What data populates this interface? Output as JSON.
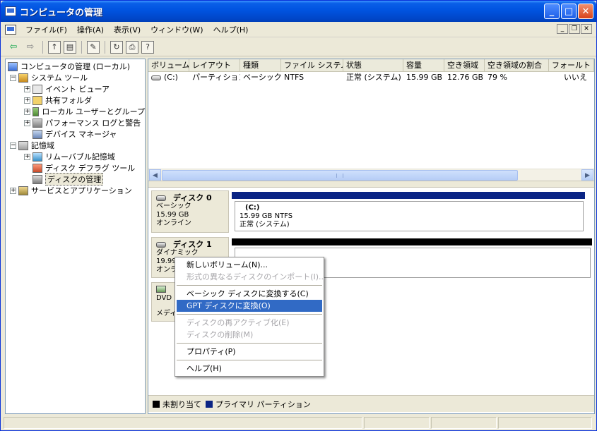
{
  "window": {
    "title": "コンピュータの管理"
  },
  "menu": {
    "items": [
      "ファイル(F)",
      "操作(A)",
      "表示(V)",
      "ウィンドウ(W)",
      "ヘルプ(H)"
    ]
  },
  "tree": {
    "items": [
      {
        "label": "コンピュータの管理 (ローカル)"
      },
      {
        "label": "システム ツール"
      },
      {
        "label": "イベント ビューア"
      },
      {
        "label": "共有フォルダ"
      },
      {
        "label": "ローカル ユーザーとグループ"
      },
      {
        "label": "パフォーマンス ログと警告"
      },
      {
        "label": "デバイス マネージャ"
      },
      {
        "label": "記憶域"
      },
      {
        "label": "リムーバブル記憶域"
      },
      {
        "label": "ディスク デフラグ ツール"
      },
      {
        "label": "ディスクの管理"
      },
      {
        "label": "サービスとアプリケーション"
      }
    ]
  },
  "volume_list": {
    "columns": [
      "ボリューム",
      "レイアウト",
      "種類",
      "ファイル システム",
      "状態",
      "容量",
      "空き領域",
      "空き領域の割合",
      "フォールト トレ"
    ],
    "rows": [
      {
        "volume": "(C:)",
        "layout": "パーティション",
        "type": "ベーシック",
        "fs": "NTFS",
        "status": "正常 (システム)",
        "capacity": "15.99 GB",
        "free": "12.76 GB",
        "free_pct": "79 %",
        "fault": "いいえ"
      }
    ]
  },
  "disks": {
    "disk0": {
      "name": "ディスク 0",
      "type": "ベーシック",
      "size": "15.99 GB",
      "state": "オンライン",
      "partition": {
        "name": "(C:)",
        "info": "15.99 GB NTFS",
        "status": "正常 (システム)"
      }
    },
    "disk1": {
      "name": "ディスク 1",
      "type": "ダイナミック",
      "size": "19.99",
      "state": "オンラ"
    },
    "dvd": {
      "name": "DVD",
      "media": "メディ"
    }
  },
  "legend": {
    "unallocated": "未割り当て",
    "primary": "プライマリ パーティション"
  },
  "context_menu": {
    "new_volume": "新しいボリューム(N)...",
    "import_foreign": "形式の異なるディスクのインポート(I)...",
    "convert_basic": "ベーシック ディスクに変換する(C)",
    "convert_gpt": "GPT ディスクに変換(O)",
    "reactivate": "ディスクの再アクティブ化(E)",
    "remove_disk": "ディスクの削除(M)",
    "properties": "プロパティ(P)",
    "help": "ヘルプ(H)"
  },
  "colors": {
    "titlebar": "#0053e0",
    "primary_partition": "#0a2484",
    "unallocated": "#000000",
    "highlight": "#316ac5"
  }
}
